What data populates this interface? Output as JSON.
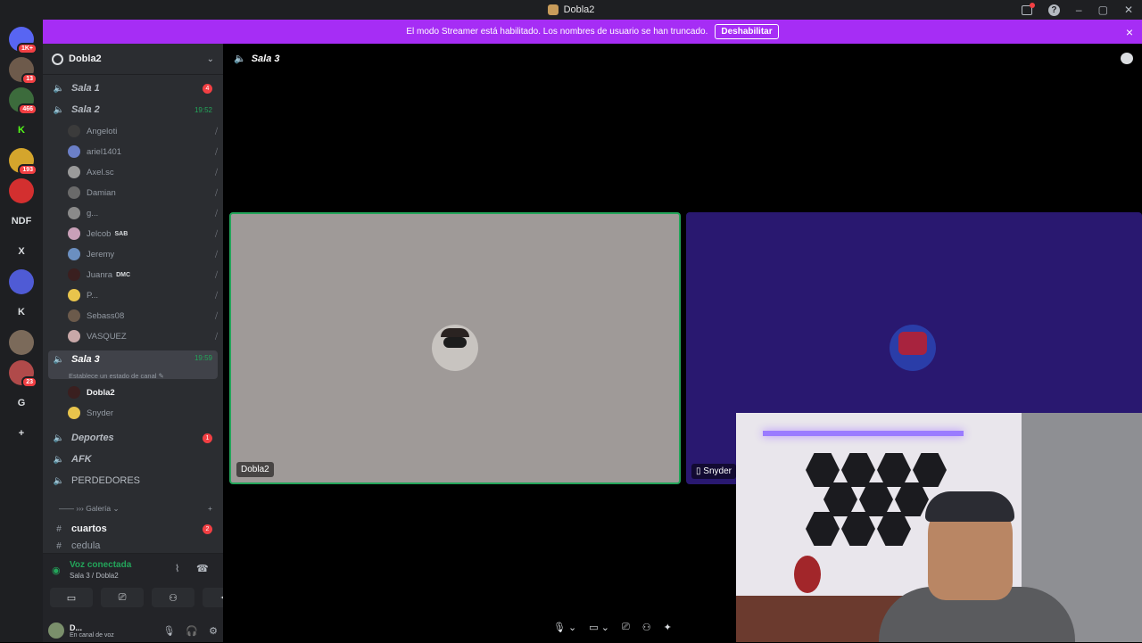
{
  "window": {
    "title": "Dobla2"
  },
  "banner": {
    "text": "El modo Streamer está habilitado. Los nombres de usuario se han truncado.",
    "button": "Deshabilitar",
    "close": "×"
  },
  "guilds": [
    {
      "label": "1K+",
      "color": "#5865f2"
    },
    {
      "label": "13",
      "color": "#6d5a4b"
    },
    {
      "label": "466",
      "color": "#3c6b3c"
    },
    {
      "label": "K",
      "color": "#1e1f22",
      "fg": "#53fc18"
    },
    {
      "label": "193",
      "color": "#d4a52c"
    },
    {
      "label": "",
      "color": "#d32f2f"
    },
    {
      "label": "NDF",
      "color": "#1e1f22"
    },
    {
      "label": "X",
      "color": "#1e1f22"
    },
    {
      "label": "",
      "color": "#4f5bd5"
    },
    {
      "label": "K",
      "color": "#1e1f22"
    },
    {
      "label": "",
      "color": "#7b6a5a"
    },
    {
      "label": "23",
      "color": "#b04a4a"
    },
    {
      "label": "G",
      "color": "#1e1f22"
    },
    {
      "label": "+",
      "color": "#1e1f22"
    },
    {
      "label": "",
      "color": "#1e1f22"
    }
  ],
  "server": {
    "name": "Dobla2"
  },
  "channels": {
    "sala1": {
      "name": "Sala 1",
      "badge": "4"
    },
    "sala2": {
      "name": "Sala 2",
      "time": "19:52"
    },
    "sala3": {
      "name": "Sala 3",
      "time": "19:59",
      "status": "Establece un estado de canal ✎"
    },
    "deportes": {
      "name": "Deportes",
      "badge": "1"
    },
    "afk": {
      "name": "AFK"
    },
    "perdedores": {
      "name": "PERDEDORES"
    },
    "galeria": {
      "name": "—— ››› Galería ⌄"
    },
    "cuartos": {
      "name": "cuartos",
      "badge": "2"
    },
    "cedula": {
      "name": "cedula"
    }
  },
  "sala2_users": [
    {
      "name": "Angeloti",
      "tag": ""
    },
    {
      "name": "ariel1401",
      "tag": ""
    },
    {
      "name": "Axel.sc",
      "tag": ""
    },
    {
      "name": "Damian",
      "tag": ""
    },
    {
      "name": "g...",
      "tag": ""
    },
    {
      "name": "Jelcob",
      "tag": "SAB"
    },
    {
      "name": "Jeremy",
      "tag": ""
    },
    {
      "name": "Juanra",
      "tag": "DMC"
    },
    {
      "name": "P...",
      "tag": ""
    },
    {
      "name": "Sebass08",
      "tag": ""
    },
    {
      "name": "VASQUEZ",
      "tag": ""
    }
  ],
  "sala3_users": [
    {
      "name": "Dobla2"
    },
    {
      "name": "Snyder"
    }
  ],
  "voice": {
    "title": "Voz conectada",
    "sub": "Sala 3 / Dobla2"
  },
  "userpanel": {
    "name": "D...",
    "status": "En canal de voz"
  },
  "stage": {
    "channel": "Sala 3",
    "tile1": {
      "label": "Dobla2"
    },
    "tile2": {
      "label": "Snyder"
    }
  }
}
